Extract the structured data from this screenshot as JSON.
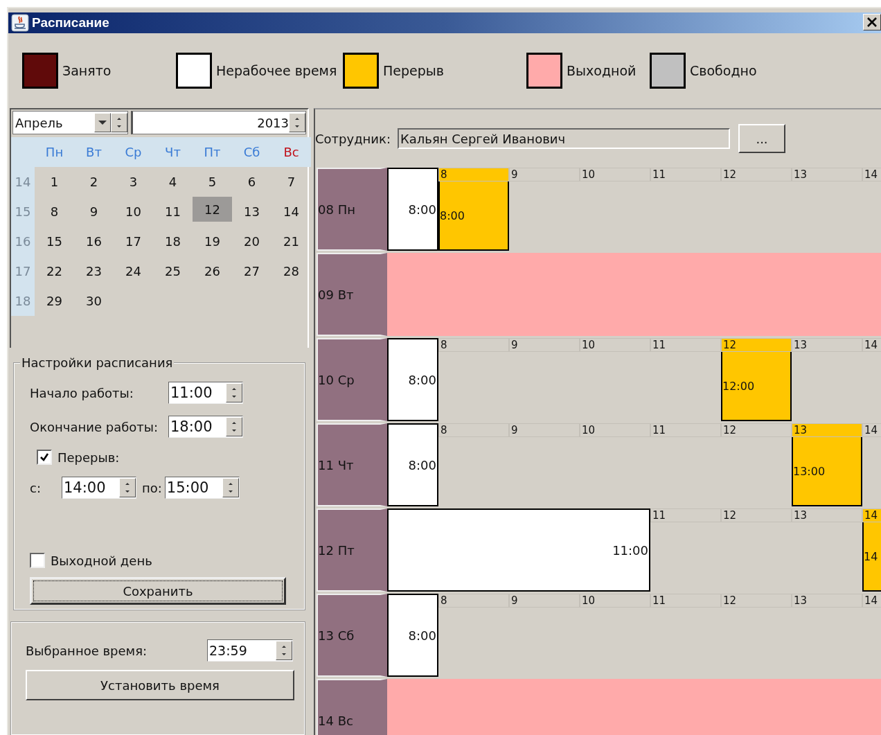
{
  "window": {
    "title": "Расписание"
  },
  "legend": [
    {
      "label": "Занято",
      "color": "#600a0a"
    },
    {
      "label": "Нерабочее время",
      "color": "#ffffff"
    },
    {
      "label": "Перерыв",
      "color": "#ffc600"
    },
    {
      "label": "Выходной",
      "color": "#ffaaaa"
    },
    {
      "label": "Свободно",
      "color": "#c0c0c0"
    }
  ],
  "calendar": {
    "month": "Апрель",
    "year": "2013",
    "weekdays": [
      {
        "label": "Пн",
        "weekend": false
      },
      {
        "label": "Вт",
        "weekend": false
      },
      {
        "label": "Ср",
        "weekend": false
      },
      {
        "label": "Чт",
        "weekend": false
      },
      {
        "label": "Пт",
        "weekend": false
      },
      {
        "label": "Сб",
        "weekend": false
      },
      {
        "label": "Вс",
        "weekend": true
      }
    ],
    "weeks": [
      {
        "number": "14",
        "days": [
          {
            "day": "1",
            "selected": false
          },
          {
            "day": "2",
            "selected": false
          },
          {
            "day": "3",
            "selected": false
          },
          {
            "day": "4",
            "selected": false
          },
          {
            "day": "5",
            "selected": false
          },
          {
            "day": "6",
            "selected": false
          },
          {
            "day": "7",
            "selected": false
          }
        ]
      },
      {
        "number": "15",
        "days": [
          {
            "day": "8",
            "selected": false
          },
          {
            "day": "9",
            "selected": false
          },
          {
            "day": "10",
            "selected": false
          },
          {
            "day": "11",
            "selected": false
          },
          {
            "day": "12",
            "selected": true
          },
          {
            "day": "13",
            "selected": false
          },
          {
            "day": "14",
            "selected": false
          }
        ]
      },
      {
        "number": "16",
        "days": [
          {
            "day": "15",
            "selected": false
          },
          {
            "day": "16",
            "selected": false
          },
          {
            "day": "17",
            "selected": false
          },
          {
            "day": "18",
            "selected": false
          },
          {
            "day": "19",
            "selected": false
          },
          {
            "day": "20",
            "selected": false
          },
          {
            "day": "21",
            "selected": false
          }
        ]
      },
      {
        "number": "17",
        "days": [
          {
            "day": "22",
            "selected": false
          },
          {
            "day": "23",
            "selected": false
          },
          {
            "day": "24",
            "selected": false
          },
          {
            "day": "25",
            "selected": false
          },
          {
            "day": "26",
            "selected": false
          },
          {
            "day": "27",
            "selected": false
          },
          {
            "day": "28",
            "selected": false
          }
        ]
      },
      {
        "number": "18",
        "days": [
          {
            "day": "29",
            "selected": false
          },
          {
            "day": "30",
            "selected": false
          }
        ]
      }
    ]
  },
  "settings": {
    "title": "Настройки расписания",
    "start_label": "Начало работы:",
    "start": "11:00",
    "end_label": "Окончание работы:",
    "end": "18:00",
    "break": {
      "label": "Перерыв:",
      "checked": true,
      "from_label": "с:",
      "from": "14:00",
      "to_label": "по:",
      "to": "15:00"
    },
    "day_off": {
      "label": "Выходной день",
      "checked": false
    },
    "save_button": "Сохранить"
  },
  "selected_time": {
    "label": "Выбранное время:",
    "value": "23:59",
    "button": "Установить время"
  },
  "employee": {
    "label": "Сотрудник:",
    "value": "Кальян Сергей Иванович",
    "button": "..."
  },
  "days": [
    {
      "label": "08 Пн",
      "kind": "work",
      "nonwork_label": "8:00",
      "hours": [
        {
          "hour": "8",
          "break": true,
          "break_label": "8:00"
        },
        {
          "hour": "9",
          "break": false
        },
        {
          "hour": "10",
          "break": false
        },
        {
          "hour": "11",
          "break": false
        },
        {
          "hour": "12",
          "break": false
        },
        {
          "hour": "13",
          "break": false
        },
        {
          "hour": "14",
          "break": false
        }
      ]
    },
    {
      "label": "09 Вт",
      "kind": "dayoff"
    },
    {
      "label": "10 Ср",
      "kind": "work",
      "nonwork_label": "8:00",
      "hours": [
        {
          "hour": "8",
          "break": false
        },
        {
          "hour": "9",
          "break": false
        },
        {
          "hour": "10",
          "break": false
        },
        {
          "hour": "11",
          "break": false
        },
        {
          "hour": "12",
          "break": true,
          "break_label": "12:00"
        },
        {
          "hour": "13",
          "break": false
        },
        {
          "hour": "14",
          "break": false
        }
      ]
    },
    {
      "label": "11 Чт",
      "kind": "work",
      "nonwork_label": "8:00",
      "hours": [
        {
          "hour": "8",
          "break": false
        },
        {
          "hour": "9",
          "break": false
        },
        {
          "hour": "10",
          "break": false
        },
        {
          "hour": "11",
          "break": false
        },
        {
          "hour": "12",
          "break": false
        },
        {
          "hour": "13",
          "break": true,
          "break_label": "13:00"
        },
        {
          "hour": "14",
          "break": false
        }
      ]
    },
    {
      "label": "12 Пт",
      "kind": "work",
      "nonwork_label": "11:00",
      "hours": [
        {
          "hour": "11",
          "break": false
        },
        {
          "hour": "12",
          "break": false
        },
        {
          "hour": "13",
          "break": false
        },
        {
          "hour": "14",
          "break": true,
          "break_label": "14"
        }
      ]
    },
    {
      "label": "13 Сб",
      "kind": "work",
      "nonwork_label": "8:00",
      "hours": [
        {
          "hour": "8",
          "break": false
        },
        {
          "hour": "9",
          "break": false
        },
        {
          "hour": "10",
          "break": false
        },
        {
          "hour": "11",
          "break": false
        },
        {
          "hour": "12",
          "break": false
        },
        {
          "hour": "13",
          "break": false
        },
        {
          "hour": "14",
          "break": false
        }
      ]
    },
    {
      "label": "14 Вс",
      "kind": "dayoff"
    }
  ]
}
